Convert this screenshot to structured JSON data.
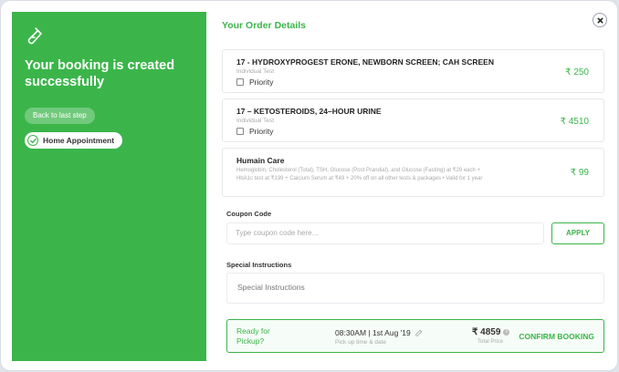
{
  "success_panel": {
    "headline": "Your booking is created successfully",
    "back_label": "Back to last step",
    "home_label": "Home Appointment",
    "accent": "#3bb54a"
  },
  "order": {
    "title": "Your Order Details",
    "items": [
      {
        "name": "17 - HYDROXYPROGEST ERONE, NEWBORN SCREEN; CAH SCREEN",
        "sub": "Individual Test",
        "priority_label": "Priority",
        "priority_checked": false,
        "price": "₹ 250"
      },
      {
        "name": "17 – KETOSTEROIDS, 24–HOUR URINE",
        "sub": "Individual Test",
        "priority_label": "Priority",
        "priority_checked": false,
        "price": "₹ 4510"
      },
      {
        "name": "Humain Care",
        "desc": "Hemoglobin, Cholesterol (Total), TSH, Glucose (Post Prandial), and Glucose (Fasting) at ₹29 each + HbA1c test at ₹199 + Calcium Serum at ₹49 + 20% off on all other tests & packages • Valid for 1 year",
        "price": "₹ 99"
      }
    ]
  },
  "coupon": {
    "label": "Coupon Code",
    "placeholder": "Type coupon code here...",
    "apply_label": "APPLY"
  },
  "instructions": {
    "label": "Special Instructions",
    "placeholder": "Special Instructions"
  },
  "footer": {
    "ready_label": "Ready for Pickup?",
    "time": "08:30AM | 1st Aug '19",
    "time_sub": "Pick up time & date",
    "total": "₹ 4859",
    "total_sub": "Total Price",
    "confirm_label": "CONFIRM BOOKING"
  }
}
